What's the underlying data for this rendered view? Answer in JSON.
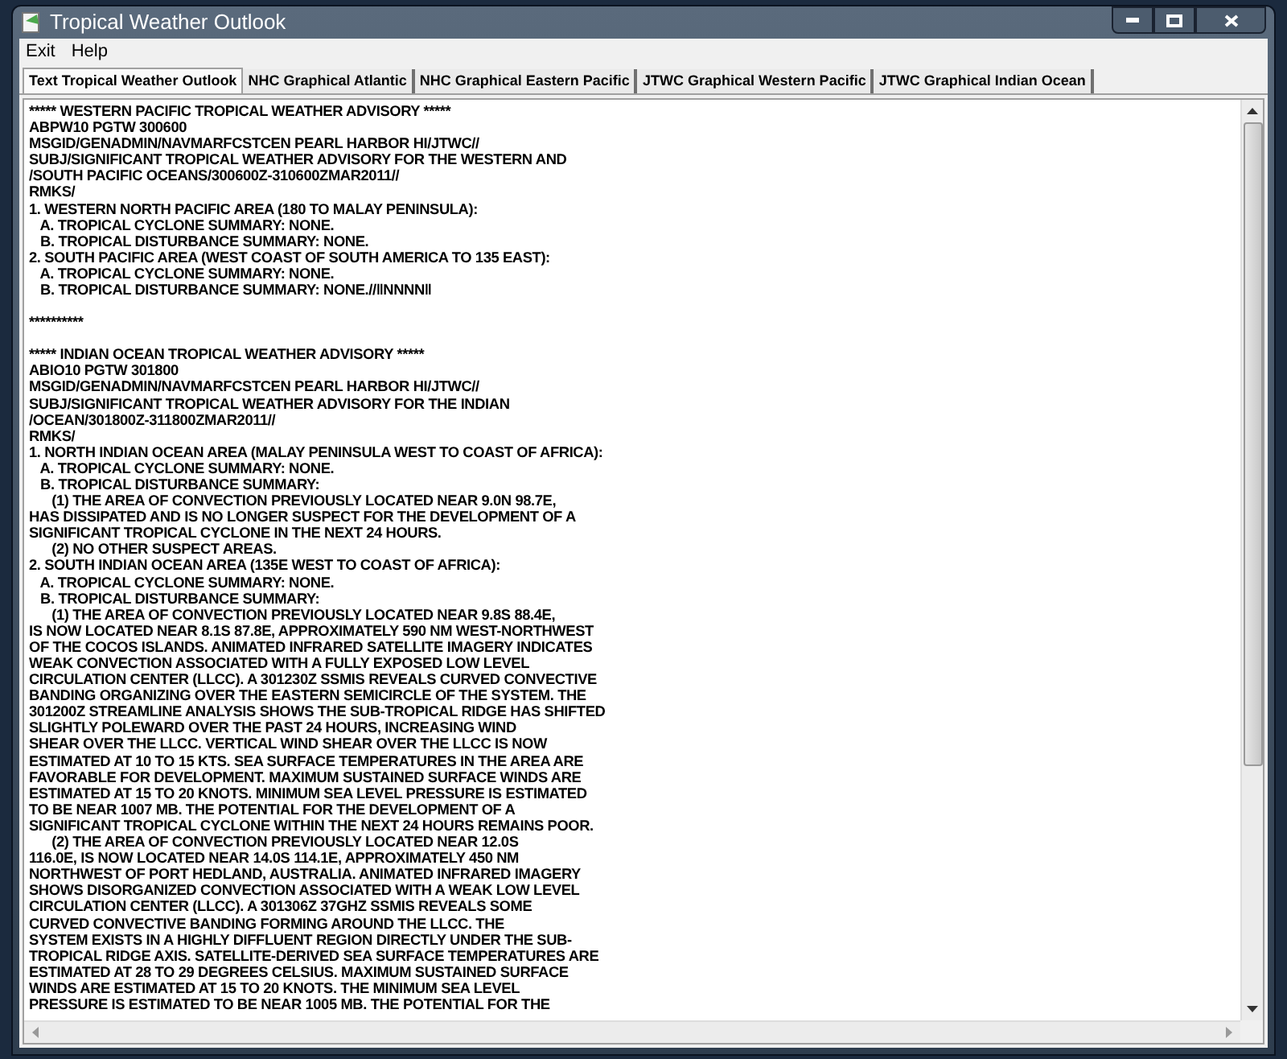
{
  "window": {
    "title": "Tropical Weather Outlook"
  },
  "menu": [
    {
      "label": "Exit"
    },
    {
      "label": "Help"
    }
  ],
  "tabs": [
    {
      "label": "Text Tropical Weather Outlook",
      "selected": true
    },
    {
      "label": "NHC Graphical Atlantic",
      "selected": false
    },
    {
      "label": "NHC Graphical Eastern Pacific",
      "selected": false
    },
    {
      "label": "JTWC Graphical Western Pacific",
      "selected": false
    },
    {
      "label": "JTWC Graphical Indian Ocean",
      "selected": false
    }
  ],
  "text_blocks": [
    [
      "***** WESTERN PACIFIC TROPICAL WEATHER ADVISORY *****",
      "ABPW10 PGTW 300600",
      "MSGID/GENADMIN/NAVMARFCSTCEN PEARL HARBOR HI/JTWC//",
      "SUBJ/SIGNIFICANT TROPICAL WEATHER ADVISORY FOR THE WESTERN AND",
      "/SOUTH PACIFIC OCEANS/300600Z-310600ZMAR2011//",
      "RMKS/",
      "1. WESTERN NORTH PACIFIC AREA (180 TO MALAY PENINSULA):",
      "   A. TROPICAL CYCLONE SUMMARY: NONE.",
      "   B. TROPICAL DISTURBANCE SUMMARY: NONE.",
      "2. SOUTH PACIFIC AREA (WEST COAST OF SOUTH AMERICA TO 135 EAST):",
      "   A. TROPICAL CYCLONE SUMMARY: NONE.",
      "   B. TROPICAL DISTURBANCE SUMMARY: NONE.//‖NNNN‖"
    ],
    [
      "**********"
    ],
    [
      "***** INDIAN OCEAN TROPICAL WEATHER ADVISORY *****",
      "ABIO10 PGTW 301800",
      "MSGID/GENADMIN/NAVMARFCSTCEN PEARL HARBOR HI/JTWC//",
      "SUBJ/SIGNIFICANT TROPICAL WEATHER ADVISORY FOR THE INDIAN",
      "/OCEAN/301800Z-311800ZMAR2011//",
      "RMKS/",
      "1. NORTH INDIAN OCEAN AREA (MALAY PENINSULA WEST TO COAST OF AFRICA):",
      "   A. TROPICAL CYCLONE SUMMARY: NONE.",
      "   B. TROPICAL DISTURBANCE SUMMARY:",
      "      (1) THE AREA OF CONVECTION PREVIOUSLY LOCATED NEAR 9.0N 98.7E,",
      "HAS DISSIPATED AND IS NO LONGER SUSPECT FOR THE DEVELOPMENT OF A",
      "SIGNIFICANT TROPICAL CYCLONE IN THE NEXT 24 HOURS.",
      "      (2) NO OTHER SUSPECT AREAS.",
      "2. SOUTH INDIAN OCEAN AREA (135E WEST TO COAST OF AFRICA):",
      "   A. TROPICAL CYCLONE SUMMARY: NONE.",
      "   B. TROPICAL DISTURBANCE SUMMARY:",
      "      (1) THE AREA OF CONVECTION PREVIOUSLY LOCATED NEAR 9.8S 88.4E,",
      "IS NOW LOCATED NEAR 8.1S 87.8E, APPROXIMATELY 590 NM WEST-NORTHWEST",
      "OF THE COCOS ISLANDS. ANIMATED INFRARED SATELLITE IMAGERY INDICATES",
      "WEAK CONVECTION ASSOCIATED WITH A FULLY EXPOSED LOW LEVEL",
      "CIRCULATION CENTER (LLCC). A 301230Z SSMIS REVEALS CURVED CONVECTIVE",
      "BANDING ORGANIZING OVER THE EASTERN SEMICIRCLE OF THE SYSTEM. THE",
      "301200Z STREAMLINE ANALYSIS SHOWS THE SUB-TROPICAL RIDGE HAS SHIFTED",
      "SLIGHTLY POLEWARD OVER THE PAST 24 HOURS, INCREASING WIND",
      "SHEAR OVER THE LLCC. VERTICAL WIND SHEAR OVER THE LLCC IS NOW",
      "ESTIMATED AT 10 TO 15 KTS. SEA SURFACE TEMPERATURES IN THE AREA ARE",
      "FAVORABLE FOR DEVELOPMENT. MAXIMUM SUSTAINED SURFACE WINDS ARE",
      "ESTIMATED AT 15 TO 20 KNOTS. MINIMUM SEA LEVEL PRESSURE IS ESTIMATED",
      "TO BE NEAR 1007 MB. THE POTENTIAL FOR THE DEVELOPMENT OF A",
      "SIGNIFICANT TROPICAL CYCLONE WITHIN THE NEXT 24 HOURS REMAINS POOR.",
      "      (2) THE AREA OF CONVECTION PREVIOUSLY LOCATED NEAR 12.0S",
      "116.0E, IS NOW LOCATED NEAR 14.0S 114.1E, APPROXIMATELY 450 NM",
      "NORTHWEST OF PORT HEDLAND, AUSTRALIA. ANIMATED INFRARED IMAGERY",
      "SHOWS DISORGANIZED CONVECTION ASSOCIATED WITH A WEAK LOW LEVEL",
      "CIRCULATION CENTER (LLCC). A 301306Z 37GHZ SSMIS REVEALS SOME",
      "CURVED CONVECTIVE BANDING FORMING AROUND THE LLCC. THE",
      "SYSTEM EXISTS IN A HIGHLY DIFFLUENT REGION DIRECTLY UNDER THE SUB-",
      "TROPICAL RIDGE AXIS. SATELLITE-DERIVED SEA SURFACE TEMPERATURES ARE",
      "ESTIMATED AT 28 TO 29 DEGREES CELSIUS. MAXIMUM SUSTAINED SURFACE",
      "WINDS ARE ESTIMATED AT 15 TO 20 KNOTS. THE MINIMUM SEA LEVEL",
      "PRESSURE IS ESTIMATED TO BE NEAR 1005 MB. THE POTENTIAL FOR THE"
    ]
  ]
}
